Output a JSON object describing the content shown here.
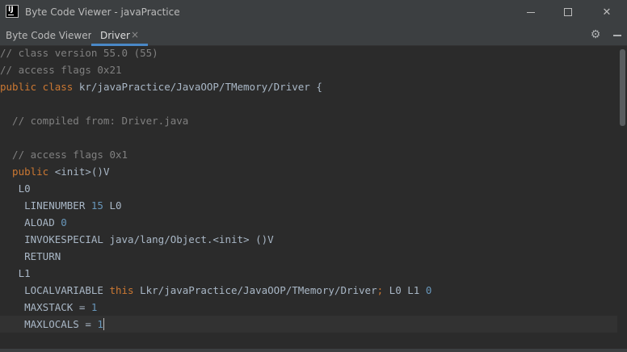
{
  "window": {
    "title": "Byte Code Viewer - javaPractice",
    "app_icon_text": "IJ",
    "minimize_icon": "minimize-icon",
    "maximize_icon": "maximize-icon",
    "close_icon": "close-icon",
    "close_glyph": "✕"
  },
  "toolbar": {
    "label": "Byte Code Viewer:",
    "tab": {
      "label": "Driver",
      "close_glyph": "×"
    },
    "settings_glyph": "⚙",
    "accent_color": "#4a88c7"
  },
  "code": {
    "lines": [
      [
        {
          "t": "// class version 55.0 (55)",
          "c": "cm"
        }
      ],
      [
        {
          "t": "// access flags 0x21",
          "c": "cm"
        }
      ],
      [
        {
          "t": "public class",
          "c": "kw"
        },
        {
          "t": " kr/javaPractice/JavaOOP/TMemory/Driver {",
          "c": "txt"
        }
      ],
      [],
      [
        {
          "t": "  // compiled from: Driver.java",
          "c": "cm"
        }
      ],
      [],
      [
        {
          "t": "  // access flags 0x1",
          "c": "cm"
        }
      ],
      [
        {
          "t": "  public",
          "c": "kw"
        },
        {
          "t": " <init>()V",
          "c": "txt"
        }
      ],
      [
        {
          "t": "   L0",
          "c": "txt"
        }
      ],
      [
        {
          "t": "    LINENUMBER ",
          "c": "txt"
        },
        {
          "t": "15",
          "c": "num"
        },
        {
          "t": " L0",
          "c": "txt"
        }
      ],
      [
        {
          "t": "    ALOAD ",
          "c": "txt"
        },
        {
          "t": "0",
          "c": "num"
        }
      ],
      [
        {
          "t": "    INVOKESPECIAL java/lang/Object.<init> ()V",
          "c": "txt"
        }
      ],
      [
        {
          "t": "    RETURN",
          "c": "txt"
        }
      ],
      [
        {
          "t": "   L1",
          "c": "txt"
        }
      ],
      [
        {
          "t": "    LOCALVARIABLE ",
          "c": "txt"
        },
        {
          "t": "this",
          "c": "kw"
        },
        {
          "t": " Lkr/javaPractice/JavaOOP/TMemory/Driver",
          "c": "txt"
        },
        {
          "t": ";",
          "c": "kw"
        },
        {
          "t": " L0 L1 ",
          "c": "txt"
        },
        {
          "t": "0",
          "c": "num"
        }
      ],
      [
        {
          "t": "    MAXSTACK = ",
          "c": "txt"
        },
        {
          "t": "1",
          "c": "num"
        }
      ],
      [
        {
          "t": "    MAXLOCALS = ",
          "c": "txt"
        },
        {
          "t": "1",
          "c": "num"
        }
      ]
    ],
    "current_line": 16
  }
}
